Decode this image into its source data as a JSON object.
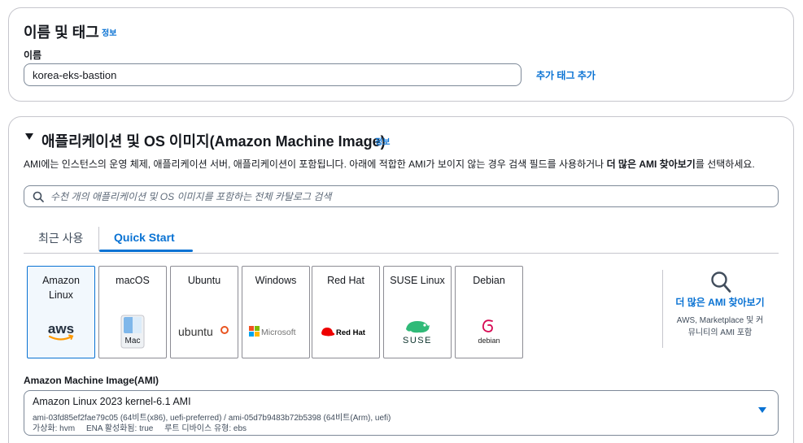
{
  "name_tags": {
    "title": "이름 및 태그",
    "info": "정보",
    "name_label": "이름",
    "name_value": "korea-eks-bastion",
    "add_tags": "추가 태그 추가"
  },
  "ami_section": {
    "title": "애플리케이션 및 OS 이미지(Amazon Machine Image)",
    "info": "정보",
    "desc_prefix": "AMI에는 인스턴스의 운영 체제, 애플리케이션 서버, 애플리케이션이 포함됩니다. 아래에 적합한 AMI가 보이지 않는 경우 검색 필드를 사용하거나",
    "desc_bold": "더 많은 AMI 찾아보기",
    "desc_suffix": "를 선택하세요.",
    "search_placeholder": "수천 개의 애플리케이션 및 OS 이미지를 포함하는 전체 카탈로그 검색",
    "tabs": [
      "최근 사용",
      "Quick Start"
    ],
    "tiles": [
      {
        "name": "Amazon Linux",
        "logo": "aws-logo"
      },
      {
        "name": "macOS",
        "logo": "mac-finder-icon",
        "logo_text": "Mac"
      },
      {
        "name": "Ubuntu",
        "logo": "ubuntu-logo",
        "logo_text": "ubuntu"
      },
      {
        "name": "Windows",
        "logo": "microsoft-logo",
        "logo_text": "Microsoft"
      },
      {
        "name": "Red Hat",
        "logo": "redhat-logo",
        "logo_text": "Red Hat"
      },
      {
        "name": "SUSE Linux",
        "logo": "suse-logo",
        "logo_text": "SUSE"
      },
      {
        "name": "Debian",
        "logo": "debian-logo",
        "logo_text": "debian"
      }
    ],
    "more_ami_title": "더 많은 AMI 찾아보기",
    "more_ami_desc_line1": "AWS, Marketplace 및 커",
    "more_ami_desc_line2": "뮤니티의 AMI 포함",
    "ami_label": "Amazon Machine Image(AMI)",
    "ami_selected": {
      "title": "Amazon Linux 2023 kernel-6.1 AMI",
      "ids": "ami-03fd85ef2fae79c05 (64비트(x86), uefi-preferred) / ami-05d7b9483b72b5398 (64비트(Arm), uefi)",
      "meta": "가상화: hvm     ENA 활성화됨: true     루트 디바이스 유형: ebs"
    }
  },
  "colors": {
    "accent": "#0972d3",
    "selected_bg": "#f2f8fd",
    "border": "#c6c6cd",
    "text": "#16191f"
  }
}
